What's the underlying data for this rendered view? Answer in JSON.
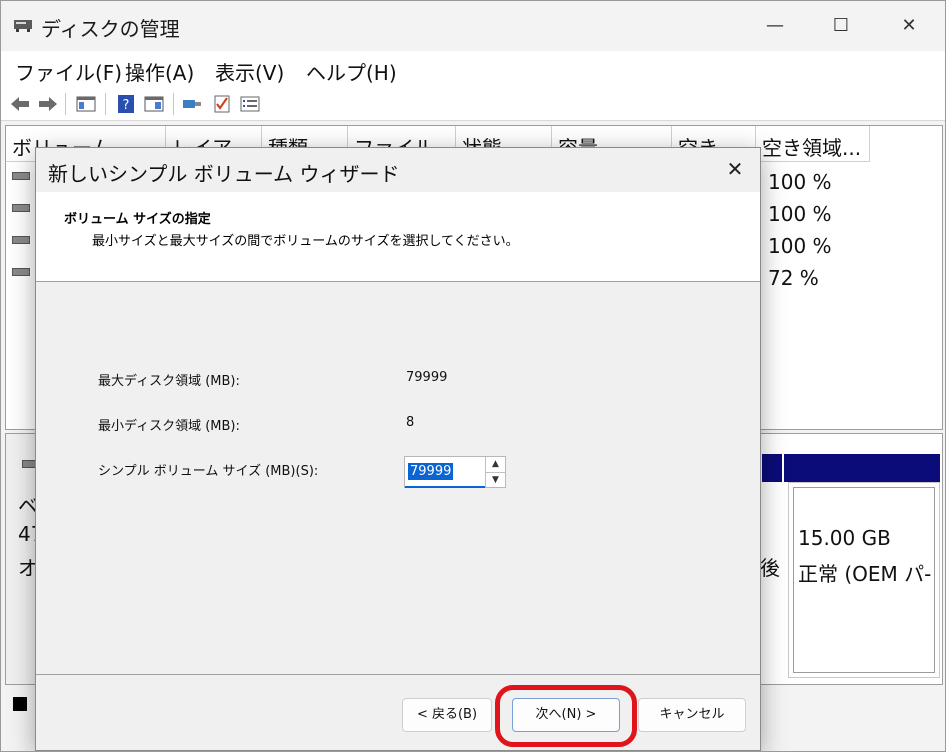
{
  "window": {
    "title": "ディスクの管理",
    "controls": {
      "minimize": "—",
      "maximize": "☐",
      "close": "✕"
    }
  },
  "menu": [
    "ファイル(F)",
    "操作(A)",
    "表示(V)",
    "ヘルプ(H)"
  ],
  "toolbar": [
    "back-icon",
    "forward-icon",
    "console-tree-icon",
    "help-icon",
    "properties-icon",
    "connect-icon",
    "check-icon",
    "list-icon"
  ],
  "list": {
    "columns": [
      "ボリューム",
      "レイア...",
      "種類",
      "ファイル...",
      "状態",
      "容量",
      "空き...",
      "空き領域..."
    ],
    "free_pct": [
      "100 %",
      "100 %",
      "100 %",
      "72 %"
    ]
  },
  "disk": {
    "label_partial": [
      "ベ",
      "47",
      "オ"
    ],
    "partition_text_cut": "後",
    "partition_size": "15.00 GB",
    "partition_status": "正常 (OEM パ-"
  },
  "dialog": {
    "title": "新しいシンプル ボリューム ウィザード",
    "close": "✕",
    "header_title": "ボリューム サイズの指定",
    "header_desc": "最小サイズと最大サイズの間でボリュームのサイズを選択してください。",
    "max_label": "最大ディスク領域 (MB):",
    "max_value": "79999",
    "min_label": "最小ディスク領域 (MB):",
    "min_value": "8",
    "size_label": "シンプル ボリューム サイズ (MB)(S):",
    "size_value": "79999",
    "spin_up": "▲",
    "spin_down": "▼",
    "back_button": "< 戻る(B)",
    "next_button": "次へ(N) >",
    "cancel_button": "キャンセル"
  },
  "colors": {
    "highlight": "#e0141b",
    "selection": "#0a64d2",
    "disk_bar": "#0b0b7a"
  }
}
